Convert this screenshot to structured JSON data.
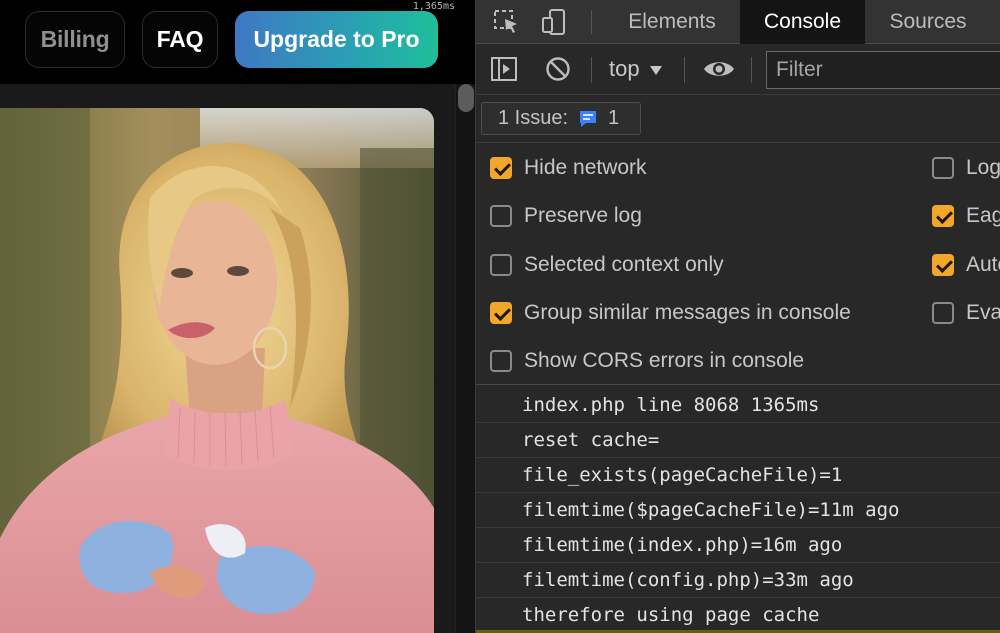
{
  "page": {
    "nav": {
      "billing": "Billing",
      "faq": "FAQ",
      "upgrade": "Upgrade to Pro"
    },
    "timing_badge": "1,365ms",
    "brand_gradient": [
      "#3f78c4",
      "#1fbf9a"
    ]
  },
  "devtools": {
    "tabs": [
      {
        "label": "Elements",
        "active": false
      },
      {
        "label": "Console",
        "active": true
      },
      {
        "label": "Sources",
        "active": false
      }
    ],
    "context": "top",
    "filter_placeholder": "Filter",
    "issues": {
      "label": "1 Issue:",
      "count": "1"
    },
    "settings_left": [
      {
        "label": "Hide network",
        "checked": true
      },
      {
        "label": "Preserve log",
        "checked": false
      },
      {
        "label": "Selected context only",
        "checked": false
      },
      {
        "label": "Group similar messages in console",
        "checked": true
      },
      {
        "label": "Show CORS errors in console",
        "checked": false
      }
    ],
    "settings_right": [
      {
        "label": "Log",
        "checked": false
      },
      {
        "label": "Eag",
        "checked": true
      },
      {
        "label": "Auto",
        "checked": true
      },
      {
        "label": "Eva",
        "checked": false
      }
    ],
    "log_lines": [
      "index.php line 8068 1365ms",
      "reset cache=",
      "file_exists(pageCacheFile)=1",
      "filemtime($pageCacheFile)=11m ago",
      "filemtime(index.php)=16m ago",
      "filemtime(config.php)=33m ago",
      "therefore using page cache"
    ],
    "accent_color": "#f2a62a"
  }
}
